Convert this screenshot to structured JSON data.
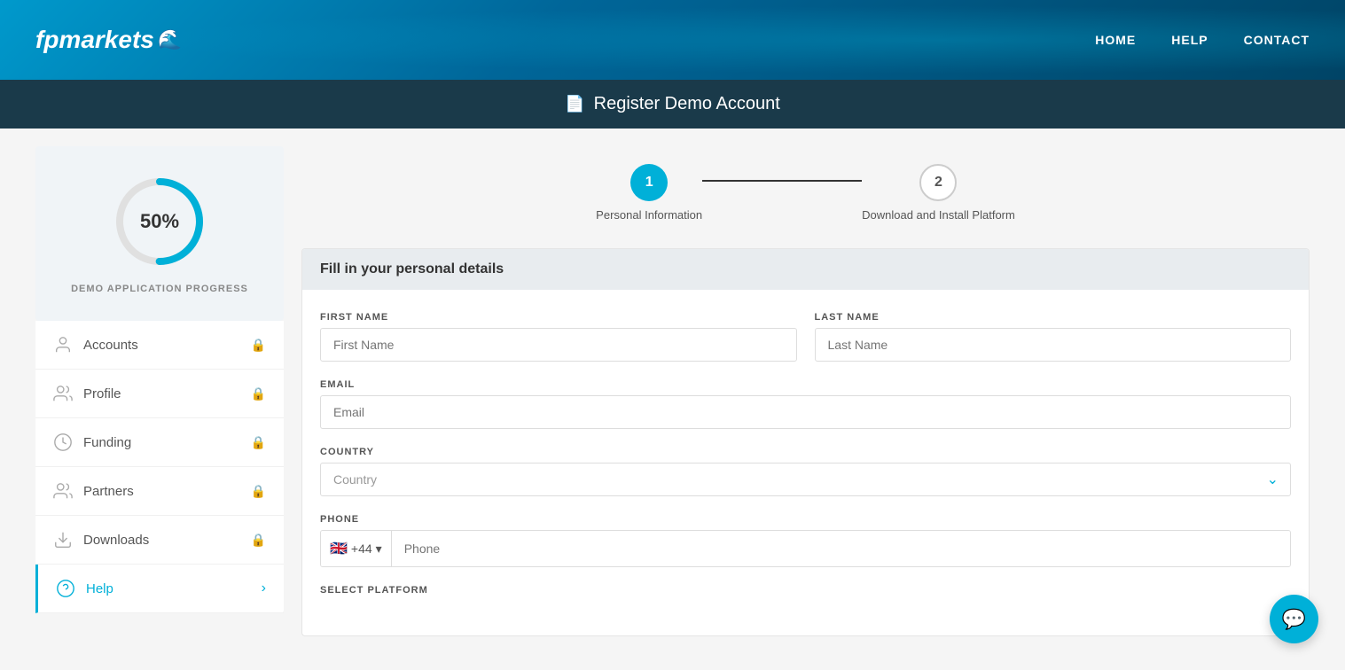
{
  "header": {
    "logo_text": "fpmarkets",
    "logo_icon": "🌊",
    "nav": {
      "home": "HOME",
      "help": "HELP",
      "contact": "CONTACT"
    }
  },
  "sub_header": {
    "icon": "📄",
    "title": "Register Demo Account"
  },
  "sidebar": {
    "progress_percent": "50%",
    "progress_label": "DEMO APPLICATION PROGRESS",
    "menu_items": [
      {
        "id": "accounts",
        "label": "Accounts",
        "icon": "accounts",
        "locked": true,
        "active": false
      },
      {
        "id": "profile",
        "label": "Profile",
        "icon": "profile",
        "locked": true,
        "active": false
      },
      {
        "id": "funding",
        "label": "Funding",
        "icon": "funding",
        "locked": true,
        "active": false
      },
      {
        "id": "partners",
        "label": "Partners",
        "icon": "partners",
        "locked": true,
        "active": false
      },
      {
        "id": "downloads",
        "label": "Downloads",
        "icon": "downloads",
        "locked": true,
        "active": false
      },
      {
        "id": "help",
        "label": "Help",
        "icon": "help",
        "locked": false,
        "active": true
      }
    ]
  },
  "steps": [
    {
      "id": 1,
      "number": "1",
      "label": "Personal Information",
      "active": true
    },
    {
      "id": 2,
      "number": "2",
      "label": "Download and Install Platform",
      "active": false
    }
  ],
  "form": {
    "header": "Fill in your personal details",
    "fields": {
      "first_name_label": "FIRST NAME",
      "first_name_placeholder": "First Name",
      "last_name_label": "LAST NAME",
      "last_name_placeholder": "Last Name",
      "email_label": "EMAIL",
      "email_placeholder": "Email",
      "country_label": "COUNTRY",
      "country_placeholder": "Country",
      "phone_label": "PHONE",
      "phone_placeholder": "Phone",
      "phone_prefix": "+44",
      "phone_flag": "🇬🇧",
      "platform_label": "SELECT PLATFORM"
    }
  }
}
